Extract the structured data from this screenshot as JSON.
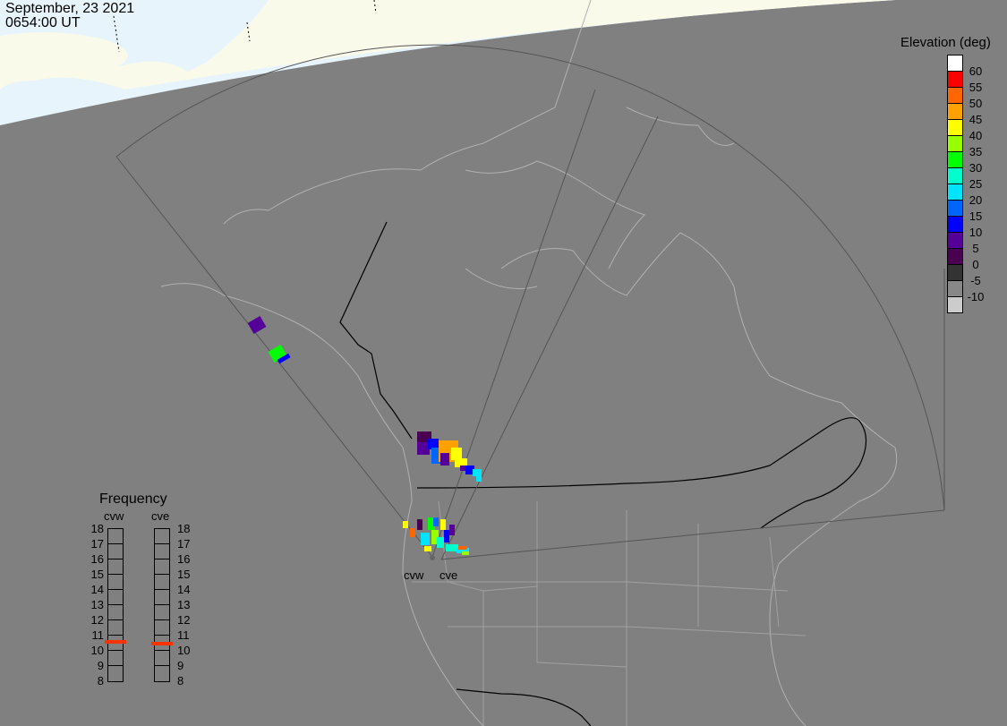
{
  "header": {
    "date": "September, 23 2021",
    "time": "0654:00 UT"
  },
  "legend": {
    "title": "Elevation (deg)",
    "levels": [
      {
        "label": "60",
        "color": "#ffffff"
      },
      {
        "label": "55",
        "color": "#ff0000"
      },
      {
        "label": "50",
        "color": "#ff6600"
      },
      {
        "label": "45",
        "color": "#ffa200"
      },
      {
        "label": "40",
        "color": "#ffff00"
      },
      {
        "label": "35",
        "color": "#99ff00"
      },
      {
        "label": "30",
        "color": "#00ff00"
      },
      {
        "label": "25",
        "color": "#00ffcc"
      },
      {
        "label": "20",
        "color": "#00e5ff"
      },
      {
        "label": "15",
        "color": "#0066ff"
      },
      {
        "label": "10",
        "color": "#0000ff"
      },
      {
        "label": "5",
        "color": "#550099"
      },
      {
        "label": "0",
        "color": "#4a0050"
      },
      {
        "label": "-5",
        "color": "#333333"
      },
      {
        "label": "-10",
        "color": "#888888"
      },
      {
        "label": "",
        "color": "#cccccc"
      }
    ]
  },
  "frequency": {
    "title": "Frequency",
    "ticks": [
      "18",
      "17",
      "16",
      "15",
      "14",
      "13",
      "12",
      "11",
      "10",
      "9",
      "8"
    ],
    "range_mhz": [
      8,
      18
    ],
    "radars": [
      {
        "name": "cvw",
        "freq_mhz": 10.6
      },
      {
        "name": "cve",
        "freq_mhz": 10.5
      }
    ]
  },
  "sites": {
    "cvw": "cvw",
    "cve": "cve"
  }
}
